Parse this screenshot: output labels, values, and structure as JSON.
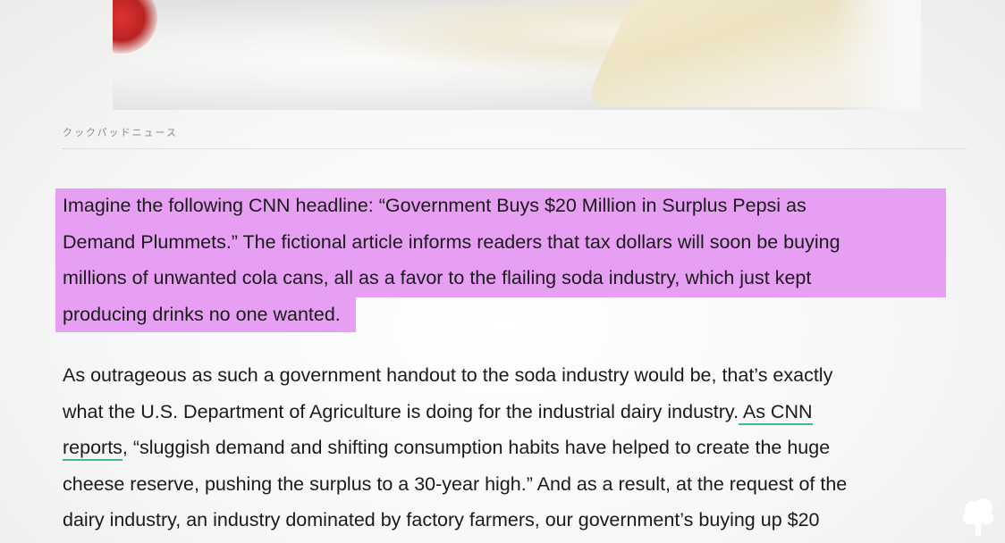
{
  "photo": {
    "alt": "cheese"
  },
  "caption": "クックパッドニュース",
  "paragraph1": {
    "lines": [
      "Imagine the following CNN headline: “Government Buys $20 Million in Surplus Pepsi as",
      "Demand Plummets.” The fictional article informs readers that tax dollars will soon be buying",
      "millions of unwanted cola cans, all as a favor to the flailing soda industry, which just kept",
      "producing drinks no one wanted."
    ],
    "highlight_color": "#e69ff2"
  },
  "paragraph2": {
    "line1": "As outrageous as such a government handout to the soda industry would be, that’s exactly",
    "line2_before": "what the U.S. Department of Agriculture is doing for the industrial dairy industry.",
    "link_part1": " As CNN",
    "link_part2": "reports",
    "line3_after": ", “sluggish demand and shifting consumption habits have helped to create the huge",
    "line4": "cheese reserve, pushing the surplus to a 30-year high.” And as a result, at the request of the",
    "line5": "dairy industry, an industry dominated by factory farmers, our government’s buying up $20",
    "link_underline_color": "#3fb79a"
  },
  "watermark": {
    "icon": "tree-logo-icon"
  }
}
